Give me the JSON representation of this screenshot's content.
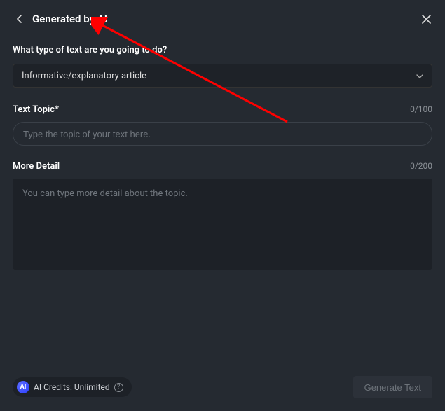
{
  "header": {
    "title": "Generated by AI"
  },
  "question": {
    "label": "What type of text are you going to do?",
    "selected": "Informative/explanatory article"
  },
  "topic": {
    "label": "Text Topic*",
    "counter": "0/100",
    "placeholder": "Type the topic of your text here."
  },
  "detail": {
    "label": "More Detail",
    "counter": "0/200",
    "placeholder": "You can type more detail about the topic."
  },
  "footer": {
    "ai_badge": "AI",
    "credits_text": "AI Credits: Unlimited",
    "generate_label": "Generate Text"
  }
}
